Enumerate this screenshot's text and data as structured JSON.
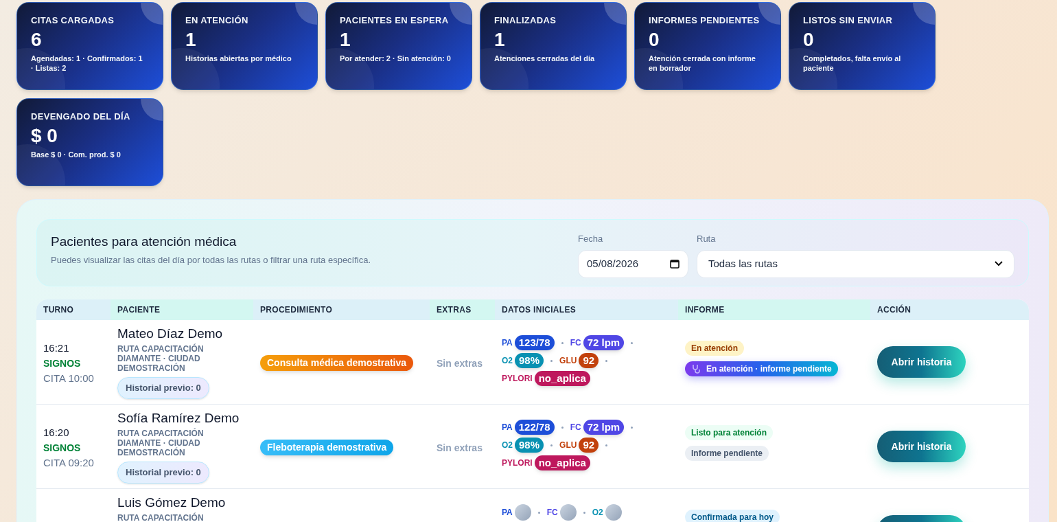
{
  "stats": [
    {
      "label": "CITAS CARGADAS",
      "value": "6",
      "note": "Agendadas: 1 · Confirmados: 1 · Listas: 2"
    },
    {
      "label": "EN ATENCIÓN",
      "value": "1",
      "note": "Historias abiertas por médico"
    },
    {
      "label": "PACIENTES EN ESPERA",
      "value": "1",
      "note": "Por atender: 2 · Sin atención: 0"
    },
    {
      "label": "FINALIZADAS",
      "value": "1",
      "note": "Atenciones cerradas del día"
    },
    {
      "label": "INFORMES PENDIENTES",
      "value": "0",
      "note": "Atención cerrada con informe en borrador"
    },
    {
      "label": "LISTOS SIN ENVIAR",
      "value": "0",
      "note": "Completados, falta envío al paciente"
    },
    {
      "label": "DEVENGADO DEL DÍA",
      "value": "$ 0",
      "note": "Base $ 0 · Com. prod. $ 0"
    }
  ],
  "panel": {
    "title": "Pacientes para atención médica",
    "subtitle": "Puedes visualizar las citas del día por todas las rutas o filtrar una ruta específica.",
    "date_field": {
      "label": "Fecha",
      "value": "05/08/2026"
    },
    "route_field": {
      "label": "Ruta",
      "value": "Todas las rutas"
    }
  },
  "table": {
    "columns": [
      "TURNO",
      "PACIENTE",
      "PROCEDIMIENTO",
      "EXTRAS",
      "DATOS INICIALES",
      "INFORME",
      "ACCIÓN"
    ],
    "rows": [
      {
        "time": "16:21",
        "stage": "SIGNOS",
        "appointment": "CITA 10:00",
        "name": "Mateo Díaz Demo",
        "route": "RUTA CAPACITACIÓN DIAMANTE · CIUDAD DEMOSTRACIÓN",
        "history": "Historial previo: 0",
        "procedure": {
          "text": "Consulta médica demostrativa",
          "kind": "orange"
        },
        "extras": "Sin extras",
        "vitals": [
          {
            "label": "PA",
            "value": "123/78",
            "color": "#1d4ed8"
          },
          {
            "label": "FC",
            "value": "72 lpm",
            "color": "#4f46e5"
          },
          {
            "label": "O2",
            "value": "98%",
            "color": "#0891b2"
          },
          {
            "label": "GLU",
            "value": "92",
            "color": "#c2410c"
          },
          {
            "label": "PYLORI",
            "value": "no_aplica",
            "color": "#be185d"
          }
        ],
        "report": [
          {
            "text": "En atención",
            "kind": "warning"
          },
          {
            "text": "En atención · informe pendiente",
            "kind": "primary"
          }
        ],
        "action": "Abrir historia"
      },
      {
        "time": "16:20",
        "stage": "SIGNOS",
        "appointment": "CITA 09:20",
        "name": "Sofía Ramírez Demo",
        "route": "RUTA CAPACITACIÓN DIAMANTE · CIUDAD DEMOSTRACIÓN",
        "history": "Historial previo: 0",
        "procedure": {
          "text": "Fleboterapia demostrativa",
          "kind": "sky"
        },
        "extras": "Sin extras",
        "vitals": [
          {
            "label": "PA",
            "value": "122/78",
            "color": "#1d4ed8"
          },
          {
            "label": "FC",
            "value": "72 lpm",
            "color": "#4f46e5"
          },
          {
            "label": "O2",
            "value": "98%",
            "color": "#0891b2"
          },
          {
            "label": "GLU",
            "value": "92",
            "color": "#c2410c"
          },
          {
            "label": "PYLORI",
            "value": "no_aplica",
            "color": "#be185d"
          }
        ],
        "report": [
          {
            "text": "Listo para atención",
            "kind": "success"
          },
          {
            "text": "Informe pendiente",
            "kind": "neutral"
          }
        ],
        "action": "Abrir historia"
      },
      {
        "name": "Luis Gómez Demo",
        "route": "RUTA CAPACITACIÓN",
        "vitals": [
          {
            "label": "PA",
            "color": "#1d4ed8"
          },
          {
            "label": "FC",
            "color": "#4f46e5"
          },
          {
            "label": "O2",
            "color": "#0891b2"
          }
        ],
        "report": [
          {
            "text": "Confirmada para hoy",
            "kind": "info"
          }
        ]
      }
    ]
  }
}
